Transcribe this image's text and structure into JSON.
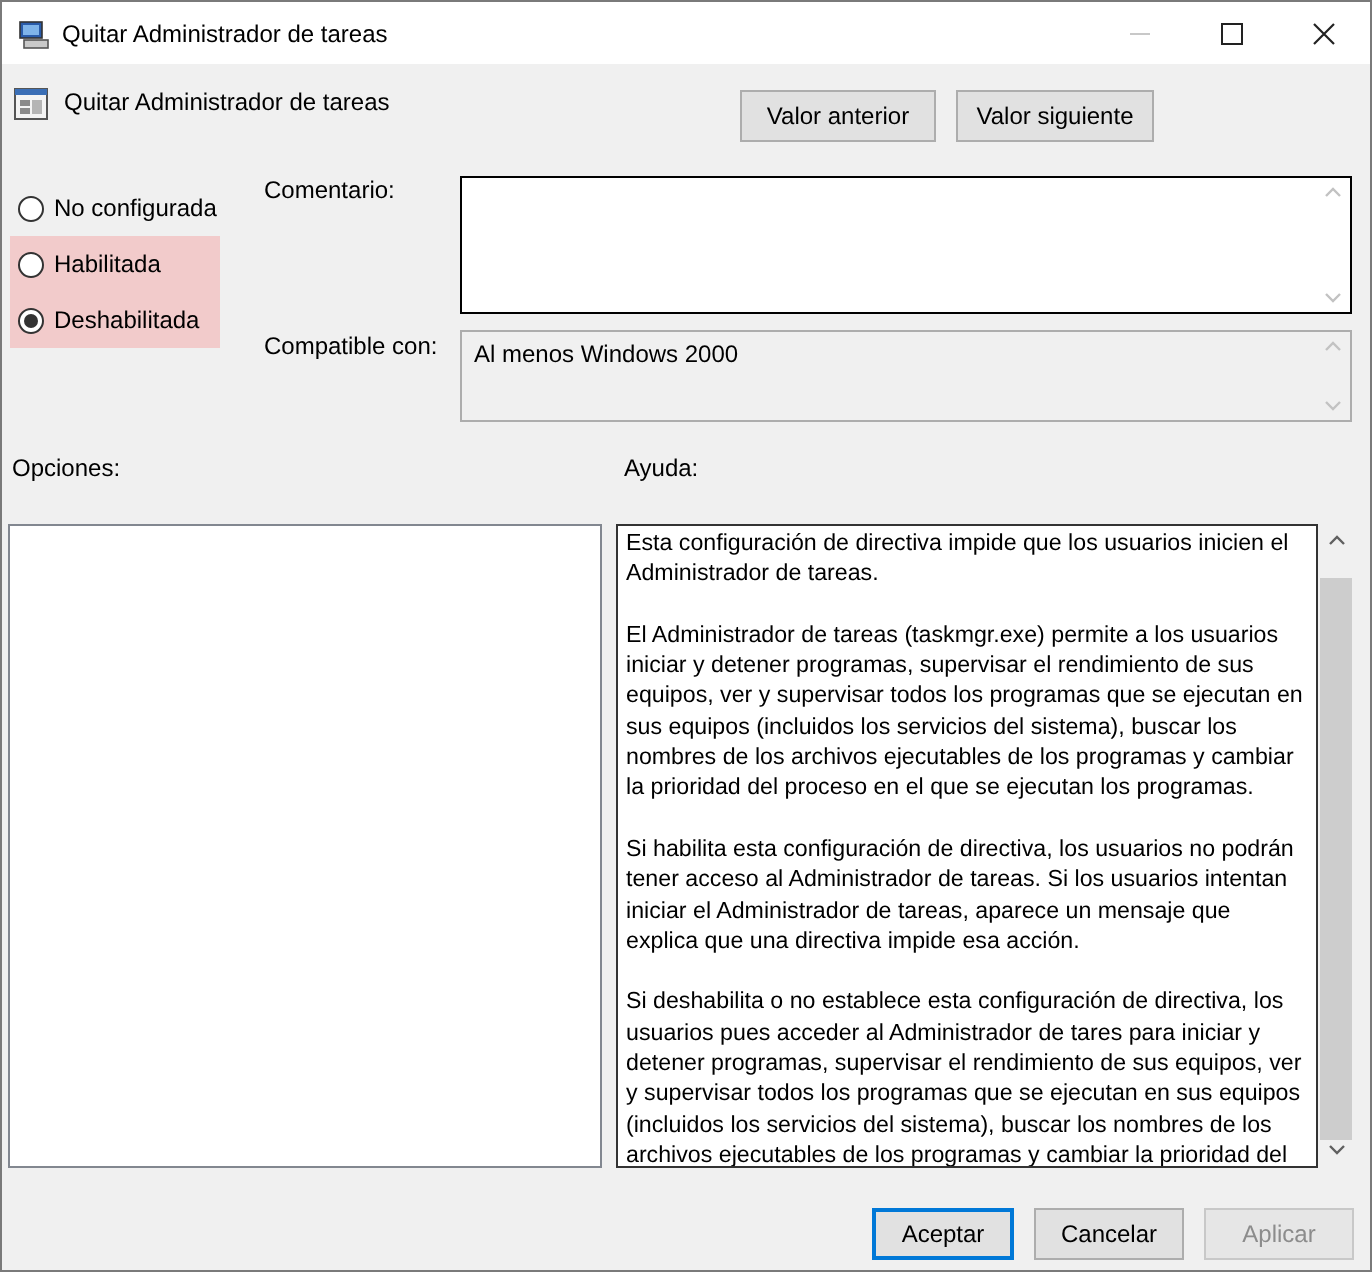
{
  "window": {
    "title": "Quitar Administrador de tareas"
  },
  "policy": {
    "name": "Quitar Administrador de tareas"
  },
  "nav_buttons": [
    {
      "label": "Valor anterior"
    },
    {
      "label": "Valor siguiente"
    }
  ],
  "states": [
    {
      "label": "No configurada",
      "selected": false,
      "highlighted": false
    },
    {
      "label": "Habilitada",
      "selected": false,
      "highlighted": true
    },
    {
      "label": "Deshabilitada",
      "selected": true,
      "highlighted": true
    }
  ],
  "comment": {
    "label": "Comentario:"
  },
  "compatible": {
    "label": "Compatible con:",
    "value": "Al menos Windows 2000"
  },
  "options": {
    "label": "Opciones:"
  },
  "help": {
    "label": "Ayuda:",
    "paragraphs": [
      [
        "Esta configuración de directiva impide que los usuarios inicien el",
        "Administrador de tareas."
      ],
      [
        "El Administrador de tareas (taskmgr.exe) permite a los usuarios",
        "iniciar y detener programas, supervisar el rendimiento de sus",
        "equipos, ver y supervisar todos los programas que se ejecutan en",
        "sus equipos (incluidos los servicios del sistema), buscar los",
        "nombres de los archivos ejecutables de los programas y cambiar",
        "la prioridad del proceso en el que se ejecutan los programas."
      ],
      [
        "Si habilita esta configuración de directiva, los usuarios no podrán",
        "tener acceso al Administrador de tareas. Si los usuarios intentan",
        "iniciar el Administrador de tareas, aparece un mensaje que",
        "explica que una directiva impide esa acción."
      ],
      [
        "Si deshabilita o no establece esta configuración de directiva, los",
        "usuarios pues acceder al Administrador de tares para iniciar y",
        "detener programas, supervisar el rendimiento de sus equipos, ver",
        "y supervisar todos los programas que se ejecutan en sus equipos",
        "(incluidos los servicios del sistema), buscar los nombres de los",
        "archivos ejecutables de los programas y cambiar la prioridad del"
      ]
    ]
  },
  "footer_buttons": [
    {
      "label": "Aceptar",
      "default": true,
      "disabled": false
    },
    {
      "label": "Cancelar",
      "default": false,
      "disabled": false
    },
    {
      "label": "Aplicar",
      "default": false,
      "disabled": true
    }
  ]
}
